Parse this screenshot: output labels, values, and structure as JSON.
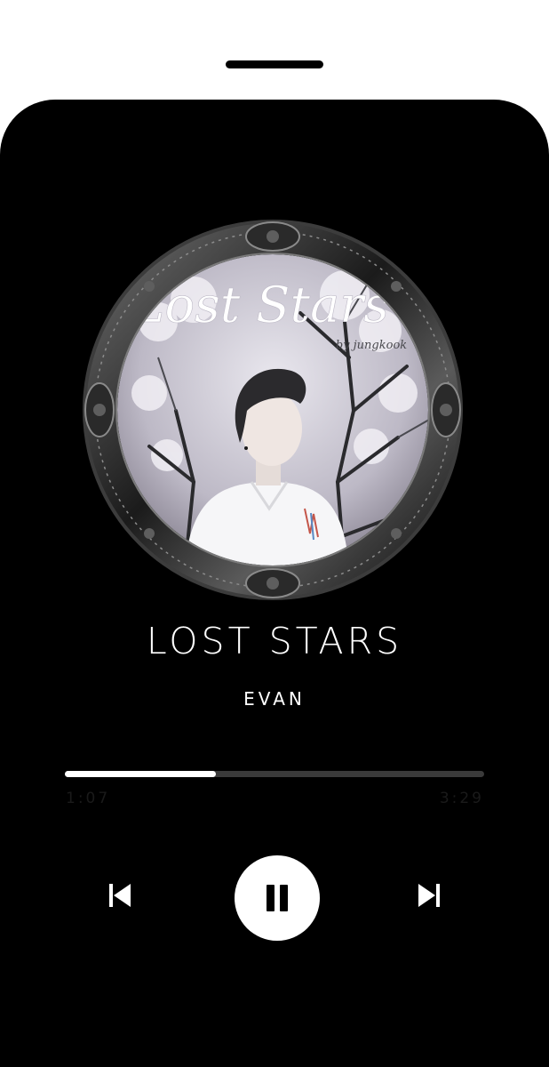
{
  "track": {
    "title": "LOST STARS",
    "artist": "EVAN",
    "art_caption": "Lost Stars",
    "art_credit": "by jungkook"
  },
  "playback": {
    "elapsed": "1:07",
    "total": "3:29",
    "progress": 0.36,
    "state": "playing"
  },
  "controls": {
    "previous_icon": "skip-previous-icon",
    "play_pause_icon": "pause-icon",
    "next_icon": "skip-next-icon"
  },
  "colors": {
    "background": "#000000",
    "accent": "#ffffff",
    "track": "#3a3a3a"
  }
}
